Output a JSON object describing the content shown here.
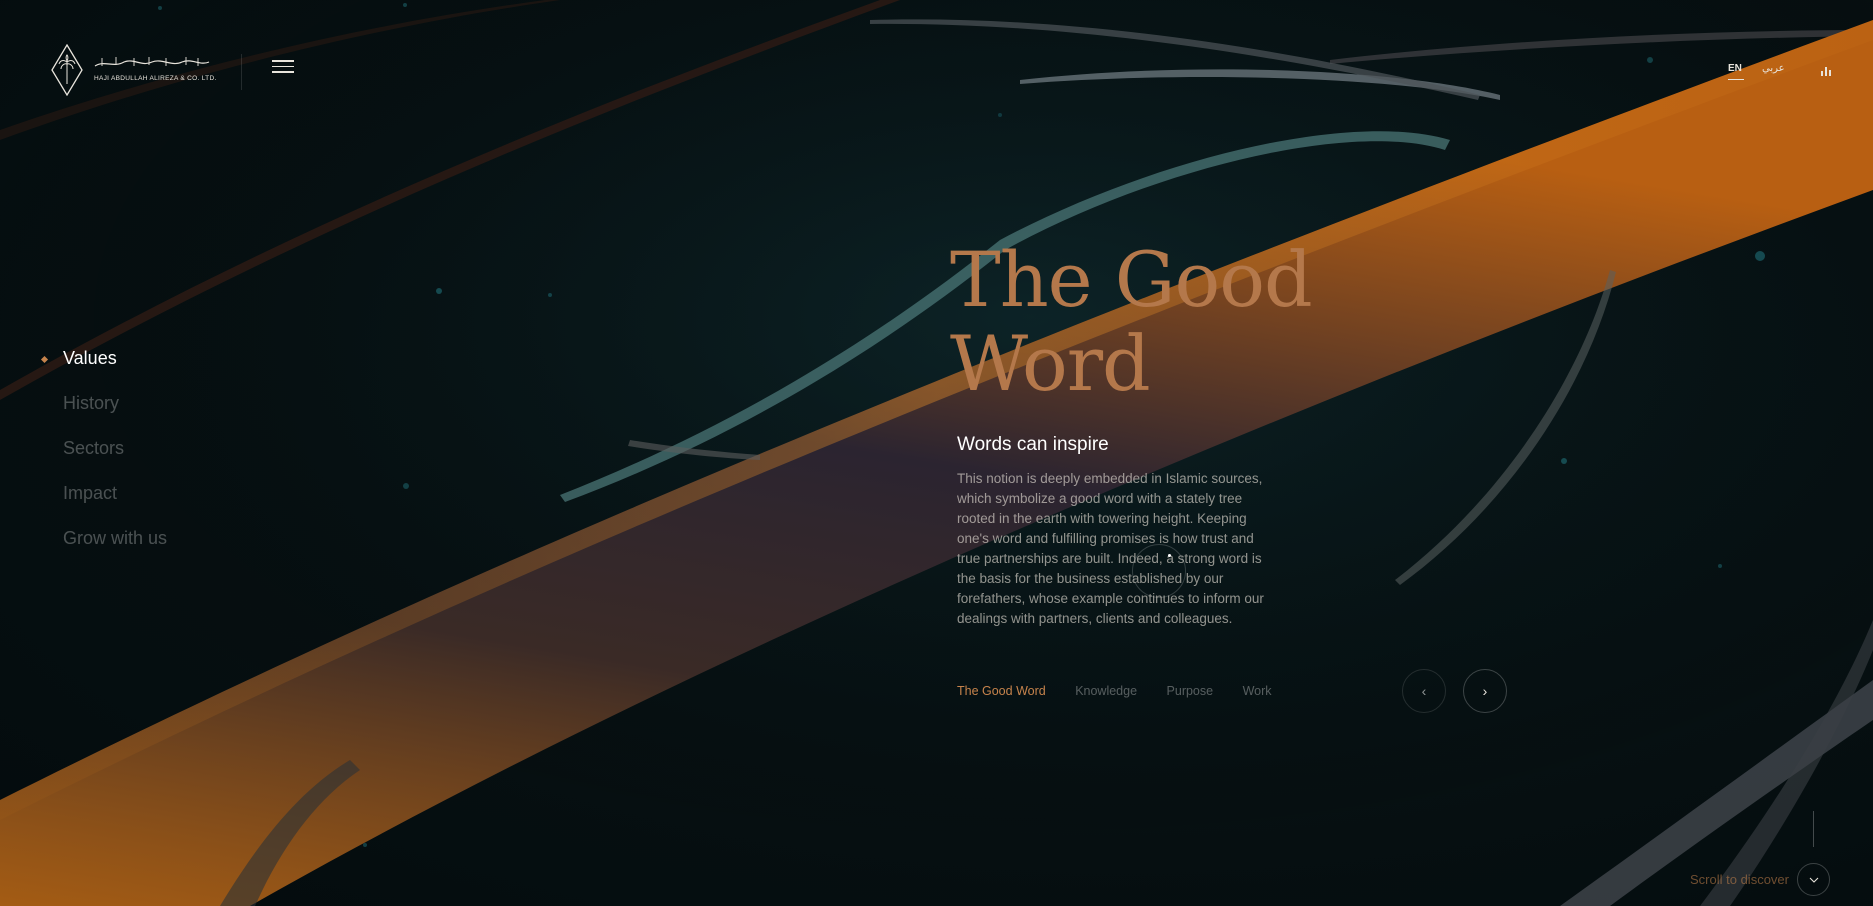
{
  "brand": {
    "name": "HAJI ABDULLAH ALIREZA & CO. LTD.",
    "accent": "#c6834c",
    "title_color": "#b4784b",
    "background": "#061012"
  },
  "header": {
    "languages": [
      "EN",
      "عربي"
    ],
    "active_language": "EN",
    "menu_icon": "hamburger-menu-icon",
    "sound_icon": "sound-bars-icon"
  },
  "side_nav": {
    "items": [
      {
        "label": "Values",
        "active": true
      },
      {
        "label": "History",
        "active": false
      },
      {
        "label": "Sectors",
        "active": false
      },
      {
        "label": "Impact",
        "active": false
      },
      {
        "label": "Grow with us",
        "active": false
      }
    ]
  },
  "slide": {
    "title_line1": "The Good",
    "title_line2": "Word",
    "subtitle": "Words can inspire",
    "body": "This notion is deeply embedded in Islamic sources, which symbolize a good word with a stately tree rooted in the earth with towering height. Keeping one's word and fulfilling promises is how trust and true partnerships are built. Indeed, a strong word is the basis for the business established by our forefathers, whose example continues to inform our dealings with partners, clients and colleagues."
  },
  "slide_tabs": [
    {
      "label": "The Good Word",
      "active": true
    },
    {
      "label": "Knowledge",
      "active": false
    },
    {
      "label": "Purpose",
      "active": false
    },
    {
      "label": "Work",
      "active": false
    }
  ],
  "arrows": {
    "prev": "‹",
    "next": "›"
  },
  "scroll": {
    "label": "Scroll to discover",
    "icon": "chevron-down-icon"
  }
}
